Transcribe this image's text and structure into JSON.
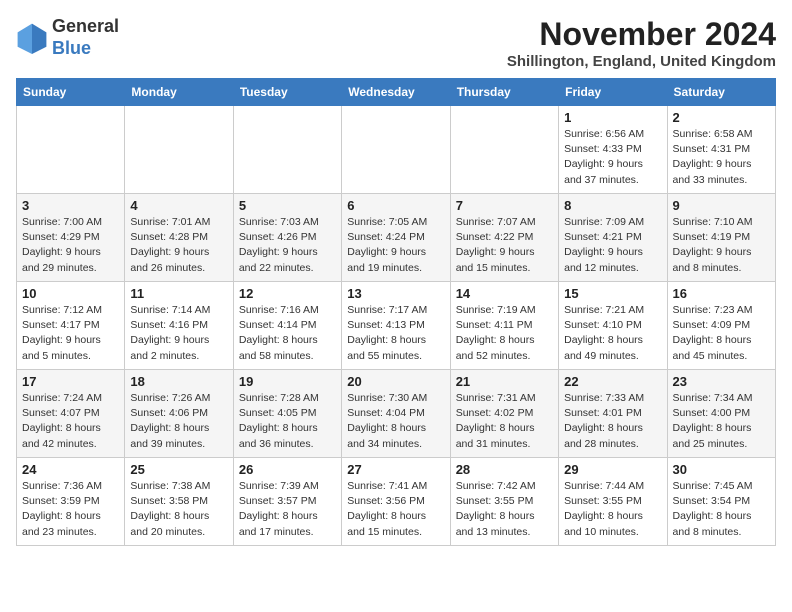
{
  "header": {
    "logo_general": "General",
    "logo_blue": "Blue",
    "month_year": "November 2024",
    "location": "Shillington, England, United Kingdom"
  },
  "weekdays": [
    "Sunday",
    "Monday",
    "Tuesday",
    "Wednesday",
    "Thursday",
    "Friday",
    "Saturday"
  ],
  "weeks": [
    [
      {
        "day": "",
        "info": ""
      },
      {
        "day": "",
        "info": ""
      },
      {
        "day": "",
        "info": ""
      },
      {
        "day": "",
        "info": ""
      },
      {
        "day": "",
        "info": ""
      },
      {
        "day": "1",
        "info": "Sunrise: 6:56 AM\nSunset: 4:33 PM\nDaylight: 9 hours\nand 37 minutes."
      },
      {
        "day": "2",
        "info": "Sunrise: 6:58 AM\nSunset: 4:31 PM\nDaylight: 9 hours\nand 33 minutes."
      }
    ],
    [
      {
        "day": "3",
        "info": "Sunrise: 7:00 AM\nSunset: 4:29 PM\nDaylight: 9 hours\nand 29 minutes."
      },
      {
        "day": "4",
        "info": "Sunrise: 7:01 AM\nSunset: 4:28 PM\nDaylight: 9 hours\nand 26 minutes."
      },
      {
        "day": "5",
        "info": "Sunrise: 7:03 AM\nSunset: 4:26 PM\nDaylight: 9 hours\nand 22 minutes."
      },
      {
        "day": "6",
        "info": "Sunrise: 7:05 AM\nSunset: 4:24 PM\nDaylight: 9 hours\nand 19 minutes."
      },
      {
        "day": "7",
        "info": "Sunrise: 7:07 AM\nSunset: 4:22 PM\nDaylight: 9 hours\nand 15 minutes."
      },
      {
        "day": "8",
        "info": "Sunrise: 7:09 AM\nSunset: 4:21 PM\nDaylight: 9 hours\nand 12 minutes."
      },
      {
        "day": "9",
        "info": "Sunrise: 7:10 AM\nSunset: 4:19 PM\nDaylight: 9 hours\nand 8 minutes."
      }
    ],
    [
      {
        "day": "10",
        "info": "Sunrise: 7:12 AM\nSunset: 4:17 PM\nDaylight: 9 hours\nand 5 minutes."
      },
      {
        "day": "11",
        "info": "Sunrise: 7:14 AM\nSunset: 4:16 PM\nDaylight: 9 hours\nand 2 minutes."
      },
      {
        "day": "12",
        "info": "Sunrise: 7:16 AM\nSunset: 4:14 PM\nDaylight: 8 hours\nand 58 minutes."
      },
      {
        "day": "13",
        "info": "Sunrise: 7:17 AM\nSunset: 4:13 PM\nDaylight: 8 hours\nand 55 minutes."
      },
      {
        "day": "14",
        "info": "Sunrise: 7:19 AM\nSunset: 4:11 PM\nDaylight: 8 hours\nand 52 minutes."
      },
      {
        "day": "15",
        "info": "Sunrise: 7:21 AM\nSunset: 4:10 PM\nDaylight: 8 hours\nand 49 minutes."
      },
      {
        "day": "16",
        "info": "Sunrise: 7:23 AM\nSunset: 4:09 PM\nDaylight: 8 hours\nand 45 minutes."
      }
    ],
    [
      {
        "day": "17",
        "info": "Sunrise: 7:24 AM\nSunset: 4:07 PM\nDaylight: 8 hours\nand 42 minutes."
      },
      {
        "day": "18",
        "info": "Sunrise: 7:26 AM\nSunset: 4:06 PM\nDaylight: 8 hours\nand 39 minutes."
      },
      {
        "day": "19",
        "info": "Sunrise: 7:28 AM\nSunset: 4:05 PM\nDaylight: 8 hours\nand 36 minutes."
      },
      {
        "day": "20",
        "info": "Sunrise: 7:30 AM\nSunset: 4:04 PM\nDaylight: 8 hours\nand 34 minutes."
      },
      {
        "day": "21",
        "info": "Sunrise: 7:31 AM\nSunset: 4:02 PM\nDaylight: 8 hours\nand 31 minutes."
      },
      {
        "day": "22",
        "info": "Sunrise: 7:33 AM\nSunset: 4:01 PM\nDaylight: 8 hours\nand 28 minutes."
      },
      {
        "day": "23",
        "info": "Sunrise: 7:34 AM\nSunset: 4:00 PM\nDaylight: 8 hours\nand 25 minutes."
      }
    ],
    [
      {
        "day": "24",
        "info": "Sunrise: 7:36 AM\nSunset: 3:59 PM\nDaylight: 8 hours\nand 23 minutes."
      },
      {
        "day": "25",
        "info": "Sunrise: 7:38 AM\nSunset: 3:58 PM\nDaylight: 8 hours\nand 20 minutes."
      },
      {
        "day": "26",
        "info": "Sunrise: 7:39 AM\nSunset: 3:57 PM\nDaylight: 8 hours\nand 17 minutes."
      },
      {
        "day": "27",
        "info": "Sunrise: 7:41 AM\nSunset: 3:56 PM\nDaylight: 8 hours\nand 15 minutes."
      },
      {
        "day": "28",
        "info": "Sunrise: 7:42 AM\nSunset: 3:55 PM\nDaylight: 8 hours\nand 13 minutes."
      },
      {
        "day": "29",
        "info": "Sunrise: 7:44 AM\nSunset: 3:55 PM\nDaylight: 8 hours\nand 10 minutes."
      },
      {
        "day": "30",
        "info": "Sunrise: 7:45 AM\nSunset: 3:54 PM\nDaylight: 8 hours\nand 8 minutes."
      }
    ]
  ]
}
